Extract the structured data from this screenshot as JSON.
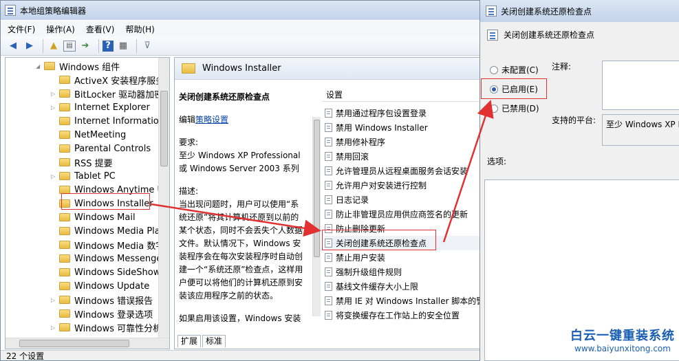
{
  "main_window": {
    "title": "本地组策略编辑器",
    "menu": [
      "文件(F)",
      "操作(A)",
      "查看(V)",
      "帮助(H)"
    ],
    "toolbar_icons": [
      "back-icon",
      "forward-icon",
      "up-folder-icon",
      "show-tree-icon",
      "export-icon",
      "help-icon",
      "properties-icon",
      "filter-icon"
    ]
  },
  "tree": {
    "items": [
      {
        "label": "Windows 组件",
        "expandable": true,
        "expanded": true,
        "indent": 0
      },
      {
        "label": "ActiveX 安装程序服务",
        "expandable": false,
        "indent": 1
      },
      {
        "label": "BitLocker 驱动器加密",
        "expandable": true,
        "indent": 1
      },
      {
        "label": "Internet Explorer",
        "expandable": true,
        "indent": 1
      },
      {
        "label": "Internet Information",
        "expandable": false,
        "indent": 1
      },
      {
        "label": "NetMeeting",
        "expandable": false,
        "indent": 1
      },
      {
        "label": "Parental Controls",
        "expandable": false,
        "indent": 1
      },
      {
        "label": "RSS 提要",
        "expandable": false,
        "indent": 1
      },
      {
        "label": "Tablet PC",
        "expandable": true,
        "indent": 1
      },
      {
        "label": "Windows Anytime Up",
        "expandable": false,
        "indent": 1
      },
      {
        "label": "Windows Installer",
        "expandable": false,
        "indent": 1,
        "selected": true
      },
      {
        "label": "Windows Mail",
        "expandable": false,
        "indent": 1
      },
      {
        "label": "Windows Media Play",
        "expandable": false,
        "indent": 1
      },
      {
        "label": "Windows Media 数字",
        "expandable": false,
        "indent": 1
      },
      {
        "label": "Windows Messenger",
        "expandable": false,
        "indent": 1
      },
      {
        "label": "Windows SideShow",
        "expandable": false,
        "indent": 1
      },
      {
        "label": "Windows Update",
        "expandable": false,
        "indent": 1
      },
      {
        "label": "Windows 错误报告",
        "expandable": true,
        "indent": 1
      },
      {
        "label": "Windows 登录选项",
        "expandable": false,
        "indent": 1
      },
      {
        "label": "Windows 可靠性分析",
        "expandable": true,
        "indent": 1
      }
    ]
  },
  "right_pane": {
    "header": "Windows Installer",
    "desc_title": "关闭创建系统还原检查点",
    "edit_prefix": "编辑",
    "edit_link": "策略设置",
    "req_label": "要求:",
    "req_text": "至少 Windows XP Professional 或 Windows Server 2003 系列",
    "desc_label": "描述:",
    "desc_text": "当出现问题时，用户可以使用“系统还原”将其计算机还原到以前的某个状态，同时不会丢失个人数据文件。默认情况下，Windows 安装程序会在每次安装程序时自动创建一个“系统还原”检查点，这样用户便可以将他们的计算机还原到安装该应用程序之前的状态。",
    "desc_more": "如果启用该设置，Windows 安装",
    "settings_header": "设置",
    "settings": [
      "禁用通过程序包设置登录",
      "禁用 Windows Installer",
      "禁用修补程序",
      "禁用回滚",
      "允许管理员从远程桌面服务会话安装",
      "允许用户对安装进行控制",
      "日志记录",
      "防止非管理员应用供应商签名的更新",
      "防止删除更新",
      "关闭创建系统还原检查点",
      "禁止用户安装",
      "强制升级组件规则",
      "基线文件缓存大小上限",
      "禁用 IE 对 Windows Installer 脚本的警",
      "将变换缓存在工作站上的安全位置"
    ],
    "tabs": [
      "扩展",
      "标准"
    ]
  },
  "status": "22 个设置",
  "dialog": {
    "title": "关闭创建系统还原检查点",
    "heading": "关闭创建系统还原检查点",
    "not_configured": "未配置(C)",
    "enabled": "已启用(E)",
    "disabled": "已禁用(D)",
    "selected": "enabled",
    "comment_label": "注释:",
    "platform_label": "支持的平台:",
    "platform_value": "至少 Windows XP P",
    "options_label": "选项:"
  },
  "watermark": {
    "title": "白云一键重装系统",
    "url": "www.baiyunxitong.com"
  },
  "colors": {
    "highlight_red": "#e03030",
    "link_blue": "#0645ad",
    "watermark_blue": "#1a5fb4"
  }
}
